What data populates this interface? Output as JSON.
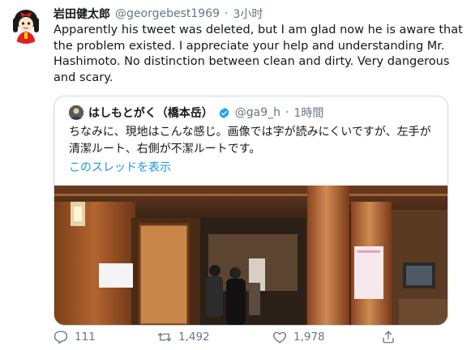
{
  "tweet": {
    "author_name": "岩田健太郎",
    "handle": "@georgebest1969",
    "separator": "·",
    "time": "3小时",
    "text": "Apparently his tweet was deleted, but I am glad now he is aware that the problem existed. I appreciate your help and understanding Mr. Hashimoto. No distinction between clean and dirty. Very dangerous and scary."
  },
  "quote": {
    "author_name": "はしもとがく（橋本岳）",
    "handle": "@ga9_h",
    "separator": "·",
    "time": "1時間",
    "text": "ちなみに、現地はこんな感じ。画像では字が読みにくいですが、左手が清潔ルート、右側が不潔ルートです。",
    "thread_link": "このスレッドを表示"
  },
  "actions": {
    "reply_count": "111",
    "retweet_count": "1,492",
    "like_count": "1,978"
  },
  "icons": {
    "reply": "reply-icon",
    "retweet": "retweet-icon",
    "like": "like-icon",
    "share": "share-icon",
    "verified": "verified-badge-icon"
  },
  "colors": {
    "link": "#1b95e0",
    "muted": "#657786",
    "border": "#ccd6dd",
    "verified": "#1da1f2"
  }
}
